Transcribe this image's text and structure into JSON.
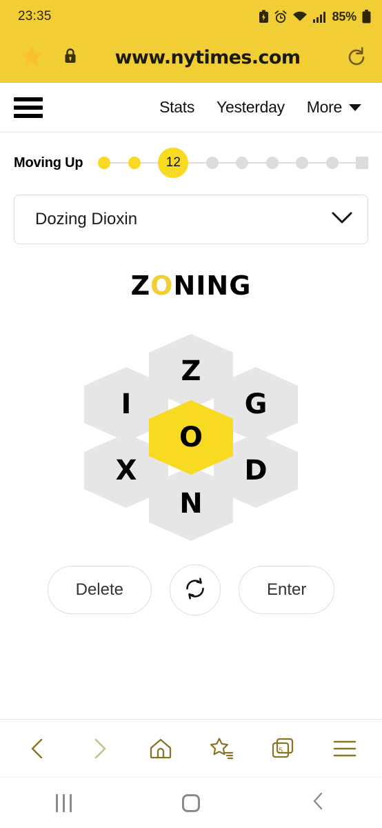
{
  "status_bar": {
    "time": "23:35",
    "battery_percent": "85%",
    "icons": [
      "battery-saver-icon",
      "alarm-icon",
      "wifi-icon",
      "cellular-signal-icon",
      "battery-icon"
    ]
  },
  "browser": {
    "url": "www.nytimes.com",
    "star_icon": "star-icon",
    "lock_icon": "lock-icon",
    "reload_icon": "reload-icon",
    "header_color": "#F2CE36",
    "toolbar": {
      "back_label": "back-icon",
      "forward_label": "forward-icon",
      "home_label": "home-icon",
      "bookmarks_label": "bookmarks-star-icon",
      "tabs_label": "tabs-icon",
      "tab_count": "5",
      "menu_label": "menu-icon",
      "accent_color": "#8a7324"
    }
  },
  "game_nav": {
    "menu_icon": "hamburger-icon",
    "links": [
      {
        "label": "Stats",
        "name": "stats"
      },
      {
        "label": "Yesterday",
        "name": "yesterday"
      },
      {
        "label": "More",
        "name": "more"
      }
    ]
  },
  "rank": {
    "label": "Moving Up",
    "score": "12",
    "completed_dots": 2,
    "remaining_dots": 5,
    "end_marker": "queen-bee-square"
  },
  "found_words": {
    "summary": "Dozing  Dioxin",
    "chevron_icon": "chevron-down-icon"
  },
  "typed_word": {
    "full": "ZONING",
    "before": "Z",
    "center": "O",
    "after": "NING",
    "center_color": "#F2CE36"
  },
  "hive": {
    "center": {
      "letter": "O",
      "pos": "center"
    },
    "outer": [
      {
        "letter": "Z",
        "pos": "top"
      },
      {
        "letter": "G",
        "pos": "top-right"
      },
      {
        "letter": "D",
        "pos": "bottom-right"
      },
      {
        "letter": "N",
        "pos": "bottom"
      },
      {
        "letter": "X",
        "pos": "bottom-left"
      },
      {
        "letter": "I",
        "pos": "top-left"
      }
    ],
    "center_color": "#F7DA21",
    "outer_color": "#E6E6E6"
  },
  "actions": {
    "delete_label": "Delete",
    "shuffle_label": "shuffle-icon",
    "enter_label": "Enter"
  },
  "android_nav": {
    "recents_label": "recents-icon",
    "home_label": "home-icon",
    "back_label": "back-icon"
  }
}
